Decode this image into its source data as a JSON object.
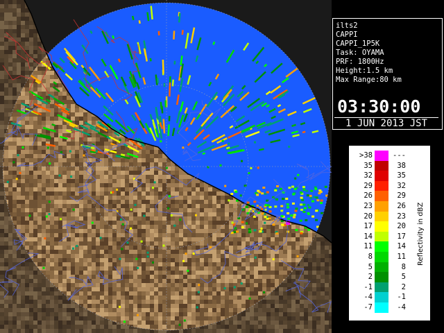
{
  "info": {
    "lines": [
      "ilts2",
      "CAPPI",
      "CAPPI_1P5K",
      "Task: OYAMA",
      "PRF: 1800Hz",
      "Height:1.5 km",
      "Max Range:80 km"
    ],
    "time": "03:30:00",
    "date": "1 JUN 2013 JST"
  },
  "legend": {
    "unit": "Reflectivity in dBZ",
    "rows": [
      {
        "lo": ">38",
        "hi": "---",
        "color": "#ff00ff"
      },
      {
        "lo": "35",
        "hi": "38",
        "color": "#c00000"
      },
      {
        "lo": "32",
        "hi": "35",
        "color": "#e00000"
      },
      {
        "lo": "29",
        "hi": "32",
        "color": "#ff2000"
      },
      {
        "lo": "26",
        "hi": "29",
        "color": "#ff6000"
      },
      {
        "lo": "23",
        "hi": "26",
        "color": "#ffa000"
      },
      {
        "lo": "20",
        "hi": "23",
        "color": "#ffd000"
      },
      {
        "lo": "17",
        "hi": "20",
        "color": "#ffff00"
      },
      {
        "lo": "14",
        "hi": "17",
        "color": "#c0ff00"
      },
      {
        "lo": "11",
        "hi": "14",
        "color": "#00ff00"
      },
      {
        "lo": "8",
        "hi": "11",
        "color": "#00d800"
      },
      {
        "lo": "5",
        "hi": "8",
        "color": "#00b000"
      },
      {
        "lo": "2",
        "hi": "5",
        "color": "#009000"
      },
      {
        "lo": "-1",
        "hi": "2",
        "color": "#00a070"
      },
      {
        "lo": "-4",
        "hi": "-1",
        "color": "#00d0d0"
      },
      {
        "lo": "-7",
        "hi": "-4",
        "color": "#00ffff"
      }
    ]
  },
  "colors": {
    "sea": "#1a5cff",
    "land": "#8a6a44",
    "land_dark": "#4a3420",
    "outside": "#0a0a0a"
  }
}
